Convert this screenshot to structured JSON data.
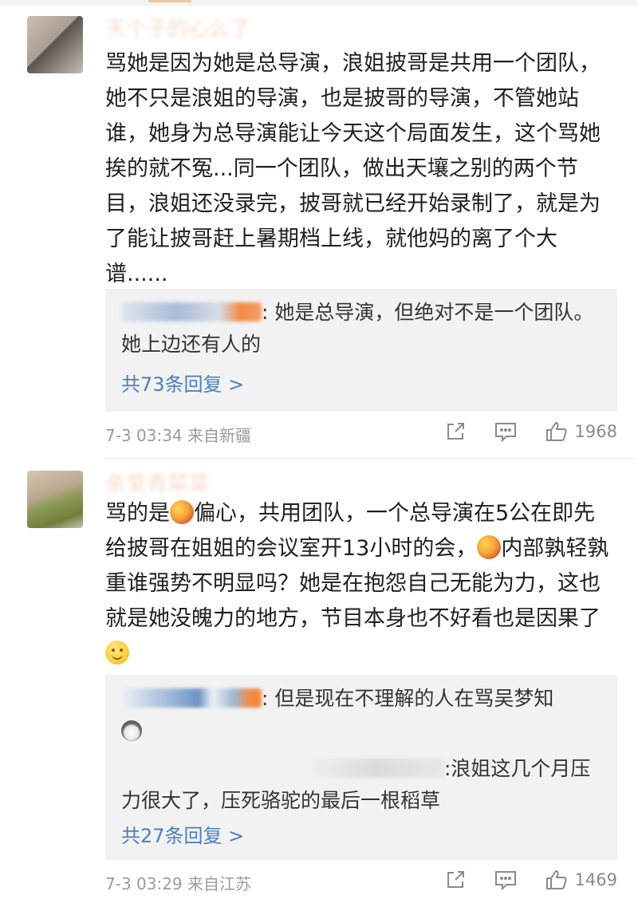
{
  "comments": [
    {
      "username": "天个子的心么了",
      "body": "骂她是因为她是总导演，浪姐披哥是共用一个团队，她不只是浪姐的导演，也是披哥的导演，不管她站谁，她身为总导演能让今天这个局面发生，这个骂她挨的就不冤...同一个团队，做出天壤之别的两个节目，浪姐还没录完，披哥就已经开始录制了，就是为了能让披哥赶上暑期档上线，就他妈的离了个大谱......",
      "replies": [
        {
          "text": ": 她是总导演，但绝对不是一个团队。她上边还有人的"
        }
      ],
      "more_replies": "共73条回复 >",
      "time": "7-3 03:34",
      "source": "来自新疆",
      "likes": "1968"
    },
    {
      "username": "亲爱青菜菜",
      "body_parts": [
        "骂的是",
        "偏心，共用团队，一个总导演在5公在即先给披哥在姐姐的会议室开13小时的会，",
        "内部孰轻孰重谁强势不明显吗？她是在抱怨自己无能为力，这也就是她没魄力的地方，节目本身也不好看也是因果了"
      ],
      "replies": [
        {
          "text": ": 但是现在不理解的人在骂吴梦知"
        },
        {
          "text": ":浪姐这几个月压力很大了，压死骆驼的最后一根稻草"
        }
      ],
      "more_replies": "共27条回复 >",
      "time": "7-3 03:29",
      "source": "来自江苏",
      "likes": "1469"
    }
  ],
  "icons": {
    "share": "share-icon",
    "comment": "comment-icon",
    "like": "thumbs-up-icon",
    "mango": "mango-emoji-icon",
    "smile": "smile-emoji-icon",
    "husky": "husky-emoji-icon"
  },
  "colors": {
    "link": "#4a7fbf",
    "reply_bg": "#f2f2f2",
    "meta": "#9a9a9a"
  }
}
